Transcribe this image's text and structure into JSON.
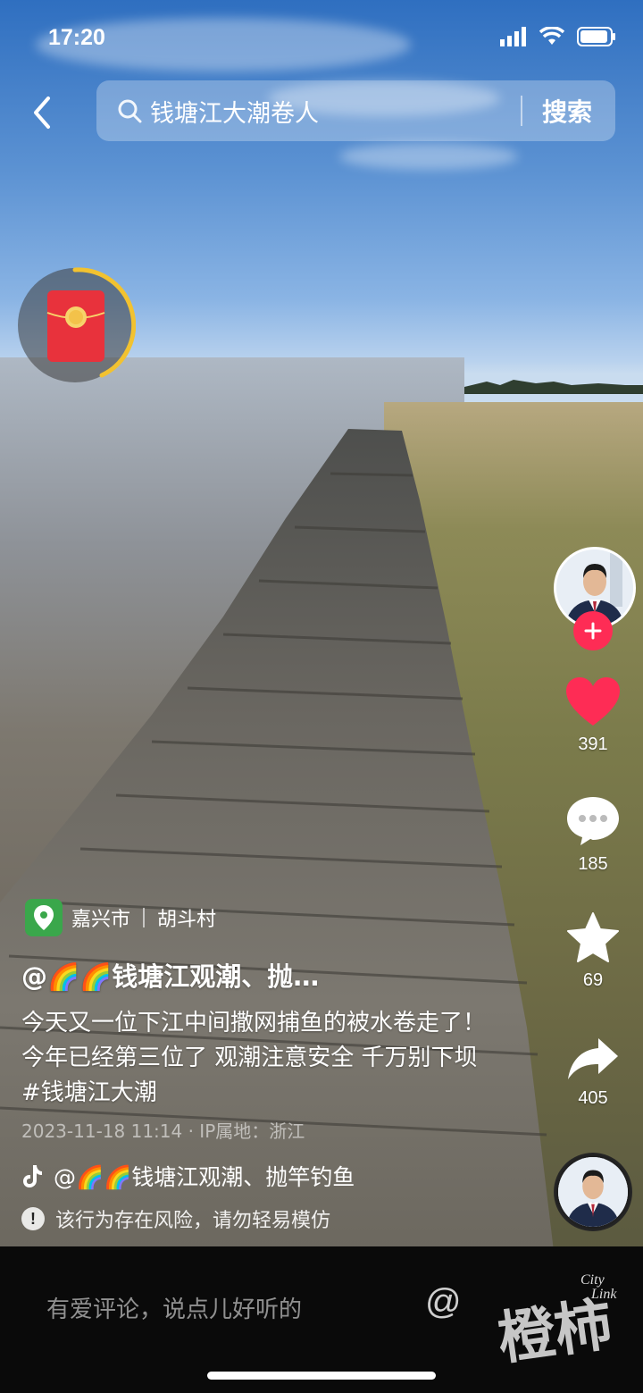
{
  "status_bar": {
    "time": "17:20"
  },
  "search": {
    "query": "钱塘江大潮卷人",
    "button": "搜索"
  },
  "actions": {
    "likes": "391",
    "comments": "185",
    "favorites": "69",
    "shares": "405"
  },
  "location": {
    "city": "嘉兴市",
    "place": "胡斗村"
  },
  "video": {
    "author": "@🌈🌈钱塘江观潮、抛…",
    "caption": "今天又一位下江中间撒网捕鱼的被水卷走了！今年已经第三位了 观潮注意安全 千万别下坝#钱塘江大潮",
    "meta": "2023-11-18 11:14 · IP属地：浙江",
    "music": "@🌈🌈钱塘江观潮、抛竿钓鱼",
    "risk_notice": "该行为存在风险，请勿轻易模仿"
  },
  "comment_bar": {
    "placeholder": "有爱评论，说点儿好听的",
    "mention": "@"
  },
  "watermark": {
    "brand": "橙柿",
    "sub": "City Link"
  },
  "colors": {
    "like_red": "#fe2c55",
    "location_green": "#3aa74b",
    "packet_red": "#e8323c"
  }
}
